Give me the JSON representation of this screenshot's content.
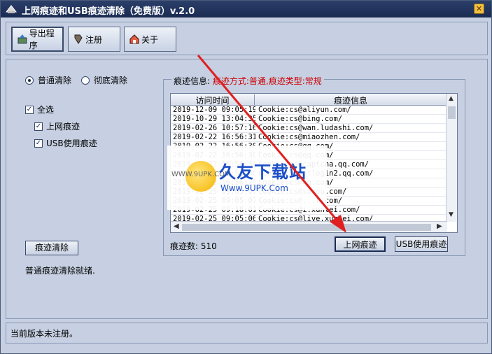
{
  "window": {
    "title": "上网痕迹和USB痕迹清除（免费版）v.2.0",
    "close_label": "✕"
  },
  "toolbar": {
    "export_label": "导出程序",
    "register_label": "注册",
    "about_label": "关于"
  },
  "options": {
    "normal_clear_label": "普通清除",
    "deep_clear_label": "彻底清除",
    "selected_mode": "普通清除",
    "select_all_label": "全选",
    "internet_traces_label": "上网痕迹",
    "usb_traces_label": "USB使用痕迹",
    "clear_button_label": "痕迹清除",
    "status_message": "普通痕迹清除就绪."
  },
  "trace_group": {
    "legend_prefix": "痕迹信息:",
    "legend_detail": "痕迹方式:普通,痕迹类型:常规",
    "columns": [
      "访问时间",
      "痕迹信息"
    ],
    "rows": [
      [
        "2019-12-09 09:05:19",
        "Cookie:cs@aliyun.com/"
      ],
      [
        "2019-10-29 13:04:35",
        "Cookie:cs@bing.com/"
      ],
      [
        "2019-02-26 10:57:16",
        "Cookie:cs@wan.ludashi.com/"
      ],
      [
        "2019-02-22 16:56:31",
        "Cookie:cs@miaozhen.com/"
      ],
      [
        "2019-02-22 16:56:30",
        "Cookie:cs@qq.com/"
      ],
      [
        "2019-02-22 16:56:30",
        "Cookie:cs@qq.com/"
      ],
      [
        "2019-02-22 16:56:30",
        "Cookie:cs@captcha.qq.com/"
      ],
      [
        "2019-02-22 16:56:30",
        "Cookie:cs@ptlogin2.qq.com/"
      ],
      [
        "2019-02-22 16:56:29",
        "Cookie:cs@qq.com/"
      ],
      [
        "2019-02-25 09:05:07",
        "Cookie:cs@sogou.com/"
      ],
      [
        "2019-02-25 09:05:07",
        "Cookie:cs@...r.com/"
      ],
      [
        "2019-02-25 09:18:01",
        "Cookie:cs@i.xunlei.com/"
      ],
      [
        "2019-02-25 09:05:06",
        "Cookie:cs@live.xunlei.com/"
      ]
    ],
    "count_label": "痕迹数:",
    "count_value": "510",
    "internet_button_label": "上网痕迹",
    "usb_button_label": "USB使用痕迹"
  },
  "watermark": {
    "url": "WWW.9UPK.COM",
    "title": "久友下载站",
    "subtitle": "Www.9UPK.Com"
  },
  "statusbar": {
    "text": "当前版本未注册。"
  },
  "colors": {
    "titlebar": "#1a2b52",
    "window_bg": "#c6d0e2",
    "accent_red": "#cc0000",
    "arrow_red": "#e02020"
  }
}
